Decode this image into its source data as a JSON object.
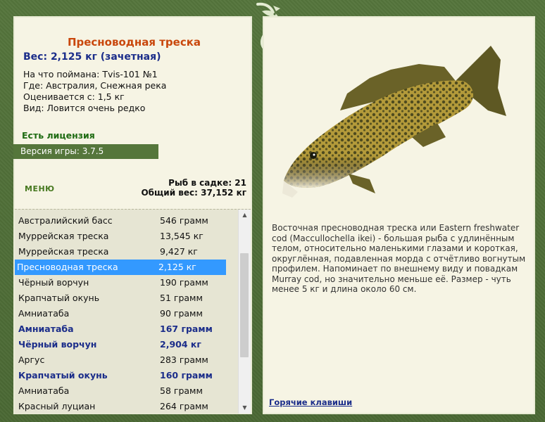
{
  "fish": {
    "title": "Пресноводная треска",
    "weight": "Вес: 2,125 кг (зачетная)",
    "caught_with": "На что поймана: Tvis-101 №1",
    "location": "Где: Австралия, Снежная река",
    "valued_from": "Оценивается с: 1,5 кг",
    "kind": "Вид: Ловится очень редко"
  },
  "license": "Есть лицензия",
  "version": "Версия игры: 3.7.5",
  "menu_label": "МЕНЮ",
  "stats": {
    "fish_count": "Рыб в садке: 21",
    "total_weight": "Общий вес: 37,152 кг"
  },
  "catch_list": [
    {
      "name": "Австралийский басс",
      "weight": "546 грамм",
      "style": "normal"
    },
    {
      "name": "Муррейская треска",
      "weight": "13,545 кг",
      "style": "normal"
    },
    {
      "name": "Муррейская треска",
      "weight": "9,427 кг",
      "style": "normal"
    },
    {
      "name": "Пресноводная треска",
      "weight": "2,125 кг",
      "style": "selected"
    },
    {
      "name": "Чёрный ворчун",
      "weight": "190 грамм",
      "style": "normal"
    },
    {
      "name": "Крапчатый окунь",
      "weight": "51 грамм",
      "style": "normal"
    },
    {
      "name": "Амниатаба",
      "weight": "90 грамм",
      "style": "normal"
    },
    {
      "name": "Амниатаба",
      "weight": "167 грамм",
      "style": "bold"
    },
    {
      "name": "Чёрный ворчун",
      "weight": "2,904 кг",
      "style": "bold"
    },
    {
      "name": "Аргус",
      "weight": "283 грамм",
      "style": "normal"
    },
    {
      "name": "Крапчатый окунь",
      "weight": "160 грамм",
      "style": "bold"
    },
    {
      "name": "Амниатаба",
      "weight": "58 грамм",
      "style": "normal"
    },
    {
      "name": "Красный луциан",
      "weight": "264 грамм",
      "style": "normal"
    }
  ],
  "description": "Восточная пресноводная треска или Eastern freshwater cod (Maccullochella ikei) - большая рыба с удлинённым телом, относительно маленькими глазами и короткая, округлённая, подавленная морда с отчётливо вогнутым профилем. Напоминает по внешнему виду и повадкам Murray cod, но значительно меньше её. Размер - чуть менее 5 кг и длина около 60 см.",
  "hotkeys_link": "Горячие клавиши",
  "icons": {
    "logo": "fish-logo-icon",
    "fish_image": "fish-image",
    "scroll_up": "scroll-up-icon",
    "scroll_down": "scroll-down-icon"
  }
}
